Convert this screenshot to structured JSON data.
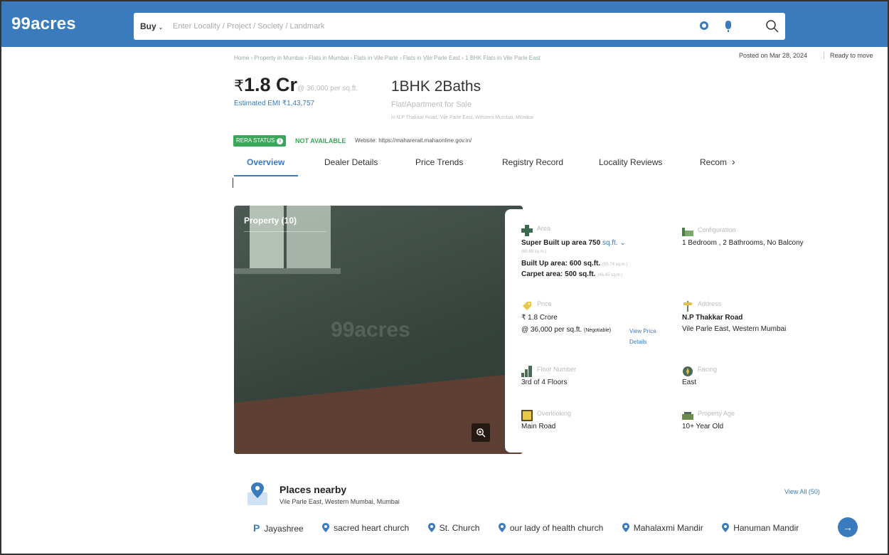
{
  "header": {
    "logo": "99acres",
    "search": {
      "buy_label": "Buy",
      "placeholder": "Enter Locality / Project / Society / Landmark"
    }
  },
  "breadcrumb": "Home › Property in Mumbai › Flats in Mumbai › Flats in Vile Parle › Flats in Vile Parle East › 1 BHK Flats in Vile Parle East",
  "posted": "Posted on Mar 28, 2024",
  "status": "Ready to move",
  "listing": {
    "price": "1.8 Cr",
    "currency": "₹",
    "per_sqft": "@ 36,000 per sq.ft.",
    "emi": "Estimated EMI ₹1,43,757",
    "title": "1BHK 2Baths",
    "type": "Flat/Apartment for Sale",
    "address": "in N.P Thakkar Road, Vile Parle East, Western Mumbai, Mumbai"
  },
  "rera": {
    "badge": "RERA STATUS",
    "status": "NOT AVAILABLE",
    "website": "Website: https://maharerait.mahaonline.gov.in/"
  },
  "tabs": [
    "Overview",
    "Dealer Details",
    "Price Trends",
    "Registry Record",
    "Locality Reviews",
    "Recom"
  ],
  "photo": {
    "label": "Property (10)",
    "watermark": "99acres"
  },
  "details": {
    "area": {
      "label": "Area",
      "super": "Super Built up area 750",
      "unit": "sq.ft.",
      "super_sub": "(69.68 sq.m.)",
      "built": "Built Up area: 600 sq.ft.",
      "built_sub": "(55.74 sq.m.)",
      "carpet": "Carpet area: 500 sq.ft.",
      "carpet_sub": "(46.45 sq.m.)"
    },
    "configuration": {
      "label": "Configuration",
      "value": "1 Bedroom , 2 Bathrooms, No Balcony"
    },
    "price": {
      "label": "Price",
      "value": "₹ 1.8 Crore",
      "per": "@ 36,000 per sq.ft.",
      "negotiable": "(Negotiable)",
      "link": "View Price Details"
    },
    "address": {
      "label": "Address",
      "line1": "N.P Thakkar Road",
      "line2": "Vile Parle East, Western Mumbai"
    },
    "floor": {
      "label": "Floor Number",
      "value": "3rd of 4 Floors"
    },
    "facing": {
      "label": "Facing",
      "value": "East"
    },
    "overlooking": {
      "label": "Overlooking",
      "value": "Main Road"
    },
    "age": {
      "label": "Property Age",
      "value": "10+ Year Old"
    }
  },
  "places": {
    "title": "Places nearby",
    "subtitle": "Vile Parle East, Western Mumbai, Mumbai",
    "view_all": "View All (50)",
    "items": [
      "Jayashree",
      "sacred heart church",
      "St. Church",
      "our lady of health church",
      "Mahalaxmi Mandir",
      "Hanuman Mandir"
    ]
  },
  "colors": {
    "brand": "#3a7bbd",
    "rera_green": "#3aa65a"
  }
}
